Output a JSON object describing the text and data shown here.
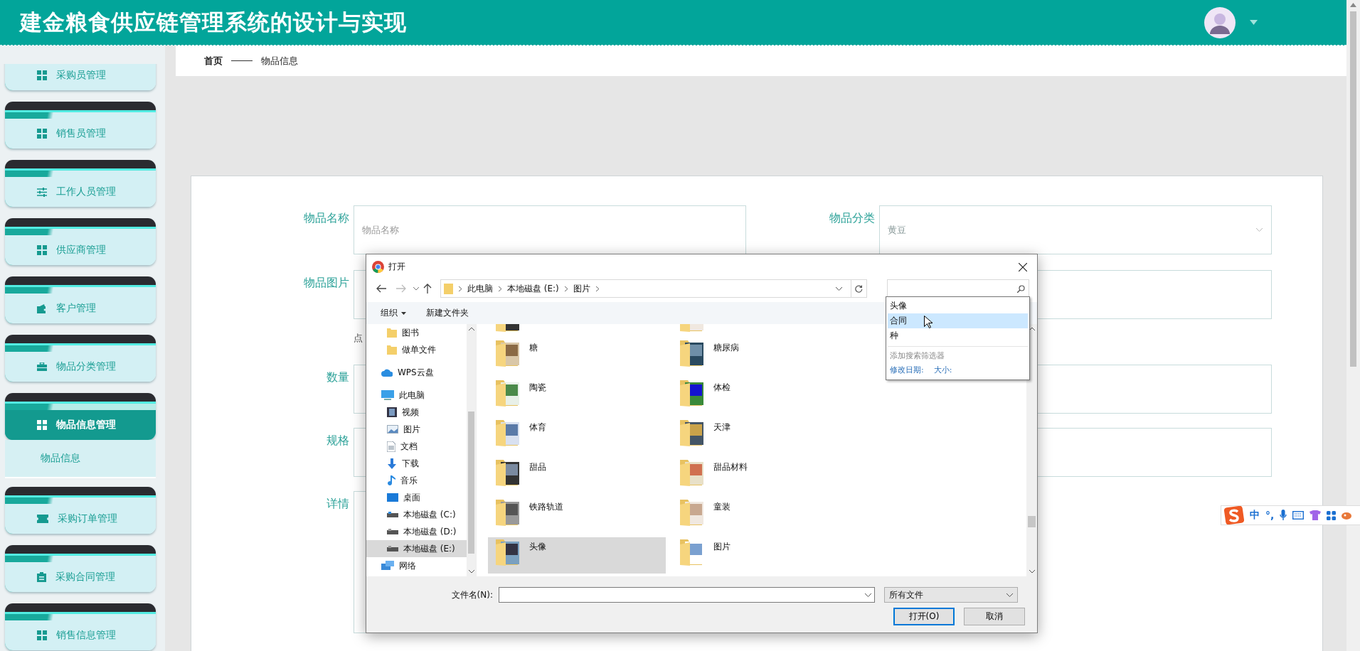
{
  "header": {
    "title": "建金粮食供应链管理系统的设计与实现"
  },
  "sidebar": {
    "items": [
      {
        "label": "采购员管理",
        "selected": false,
        "expanded": false
      },
      {
        "label": "销售员管理",
        "selected": false,
        "expanded": false
      },
      {
        "label": "工作人员管理",
        "selected": false,
        "expanded": false
      },
      {
        "label": "供应商管理",
        "selected": false,
        "expanded": false
      },
      {
        "label": "客户管理",
        "selected": false,
        "expanded": false
      },
      {
        "label": "物品分类管理",
        "selected": false,
        "expanded": false
      },
      {
        "label": "物品信息管理",
        "selected": true,
        "expanded": true,
        "children": [
          {
            "label": "物品信息"
          }
        ]
      },
      {
        "label": "采购订单管理",
        "selected": false,
        "expanded": false
      },
      {
        "label": "采购合同管理",
        "selected": false,
        "expanded": false
      },
      {
        "label": "销售信息管理",
        "selected": false,
        "expanded": false
      }
    ]
  },
  "breadcrumb": [
    "首页",
    "物品信息"
  ],
  "form": {
    "rows": [
      {
        "left": {
          "label": "物品名称",
          "kind": "input",
          "placeholder": "物品名称"
        },
        "right": {
          "label": "物品分类",
          "kind": "select",
          "value": "黄豆"
        }
      },
      {
        "left": {
          "label": "物品图片",
          "kind": "input"
        },
        "right": {
          "kind": "input"
        },
        "hint": "点"
      },
      {
        "left": {
          "label": "数量",
          "kind": "input"
        },
        "right": {
          "kind": "input"
        }
      },
      {
        "left": {
          "label": "规格",
          "kind": "input"
        },
        "right": {
          "kind": "input"
        }
      },
      {
        "left": {
          "label": "详情",
          "kind": "editor"
        }
      }
    ]
  },
  "dialog": {
    "title": "打开",
    "path": [
      "此电脑",
      "本地磁盘 (E:)",
      "图片"
    ],
    "search": {
      "suggestions": [
        {
          "label": "头像",
          "selected": false
        },
        {
          "label": "合同",
          "selected": true
        },
        {
          "label": "种",
          "selected": false
        }
      ],
      "filter_title": "添加搜索筛选器",
      "filters": [
        "修改日期:",
        "大小:"
      ]
    },
    "toolbar": [
      "组织",
      "新建文件夹"
    ],
    "nav": {
      "partial_children": [
        {
          "label": "图书",
          "selected": false
        },
        {
          "label": "做单文件",
          "selected": false
        }
      ],
      "items": [
        {
          "label": "WPS云盘",
          "selected": false
        },
        {
          "label": "此电脑",
          "selected": false,
          "children": [
            {
              "label": "视频",
              "selected": false
            },
            {
              "label": "图片",
              "selected": false
            },
            {
              "label": "文档",
              "selected": false
            },
            {
              "label": "下载",
              "selected": false
            },
            {
              "label": "音乐",
              "selected": false
            },
            {
              "label": "桌面",
              "selected": false
            },
            {
              "label": "本地磁盘 (C:)",
              "selected": false
            },
            {
              "label": "本地磁盘 (D:)",
              "selected": false
            },
            {
              "label": "本地磁盘 (E:)",
              "selected": true
            }
          ]
        },
        {
          "label": "网络",
          "selected": false
        }
      ]
    },
    "folders": [
      {
        "label": "糖",
        "selected": false
      },
      {
        "label": "糖尿病",
        "selected": false
      },
      {
        "label": "陶瓷",
        "selected": false
      },
      {
        "label": "体检",
        "selected": false
      },
      {
        "label": "体育",
        "selected": false
      },
      {
        "label": "天津",
        "selected": false
      },
      {
        "label": "甜品",
        "selected": false
      },
      {
        "label": "甜品材料",
        "selected": false
      },
      {
        "label": "铁路轨道",
        "selected": false
      },
      {
        "label": "童装",
        "selected": false
      },
      {
        "label": "头像",
        "selected": true
      },
      {
        "label": "图片",
        "selected": false
      }
    ],
    "filename_label": "文件名(N):",
    "filetype": "所有文件",
    "buttons": [
      {
        "label": "打开(O)",
        "primary": true
      },
      {
        "label": "取消",
        "primary": false
      }
    ]
  },
  "ime_bar": {
    "items": [
      "中",
      "°,"
    ]
  }
}
